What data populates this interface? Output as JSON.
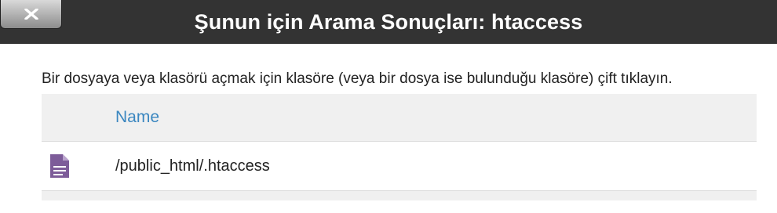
{
  "dialog": {
    "title": "Şunun için Arama Sonuçları: htaccess",
    "close_icon": "close-x-icon"
  },
  "main": {
    "instructions": "Bir dosyaya veya klasörü açmak için klasöre (veya bir dosya ise bulunduğu klasöre) çift tıklayın.",
    "table": {
      "columns": [
        "",
        "Name"
      ],
      "rows": [
        {
          "icon": "document-icon",
          "name": "/public_html/.htaccess"
        }
      ]
    }
  },
  "colors": {
    "titlebar_bg": "#333333",
    "header_text": "#3b87c0",
    "file_icon": "#7d5c99"
  }
}
